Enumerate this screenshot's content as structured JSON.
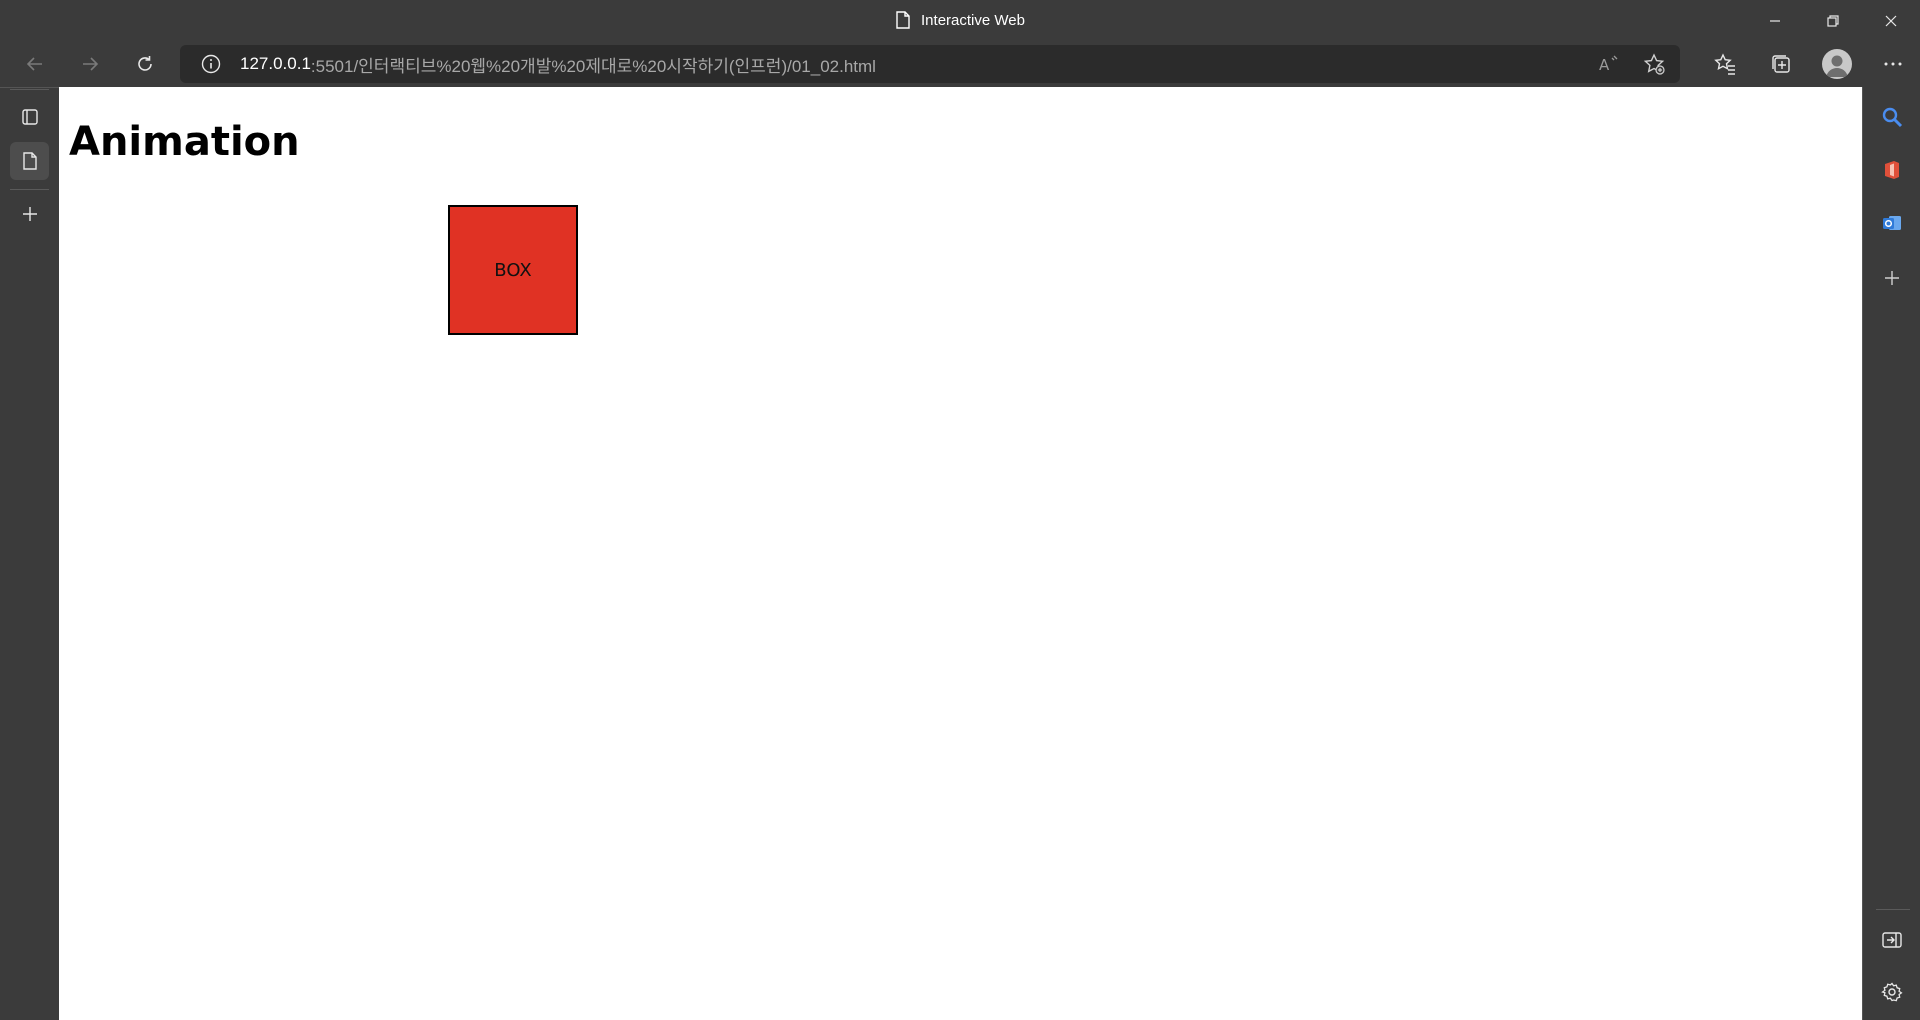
{
  "window": {
    "title": "Interactive Web"
  },
  "address_bar": {
    "url_host": "127.0.0.1",
    "url_rest": ":5501/인터랙티브%20웹%20개발%20제대로%20시작하기(인프런)/01_02.html"
  },
  "page": {
    "heading": "Animation",
    "box_label": "BOX",
    "box_color": "#e03224"
  },
  "colors": {
    "chrome": "#3b3b3b",
    "address_bg": "#2b2b2b",
    "search_icon": "#4a8df0",
    "office_icon": "#e0503a",
    "outlook_icon": "#2f7ad8"
  },
  "icons": {
    "back": "arrow-left-icon",
    "forward": "arrow-right-icon",
    "refresh": "refresh-icon",
    "site_info": "info-icon",
    "read_aloud": "read-aloud-icon",
    "add_favorite": "star-plus-icon",
    "favorites": "favorites-icon",
    "collections": "collections-icon",
    "profile": "profile-icon",
    "more": "more-icon"
  }
}
